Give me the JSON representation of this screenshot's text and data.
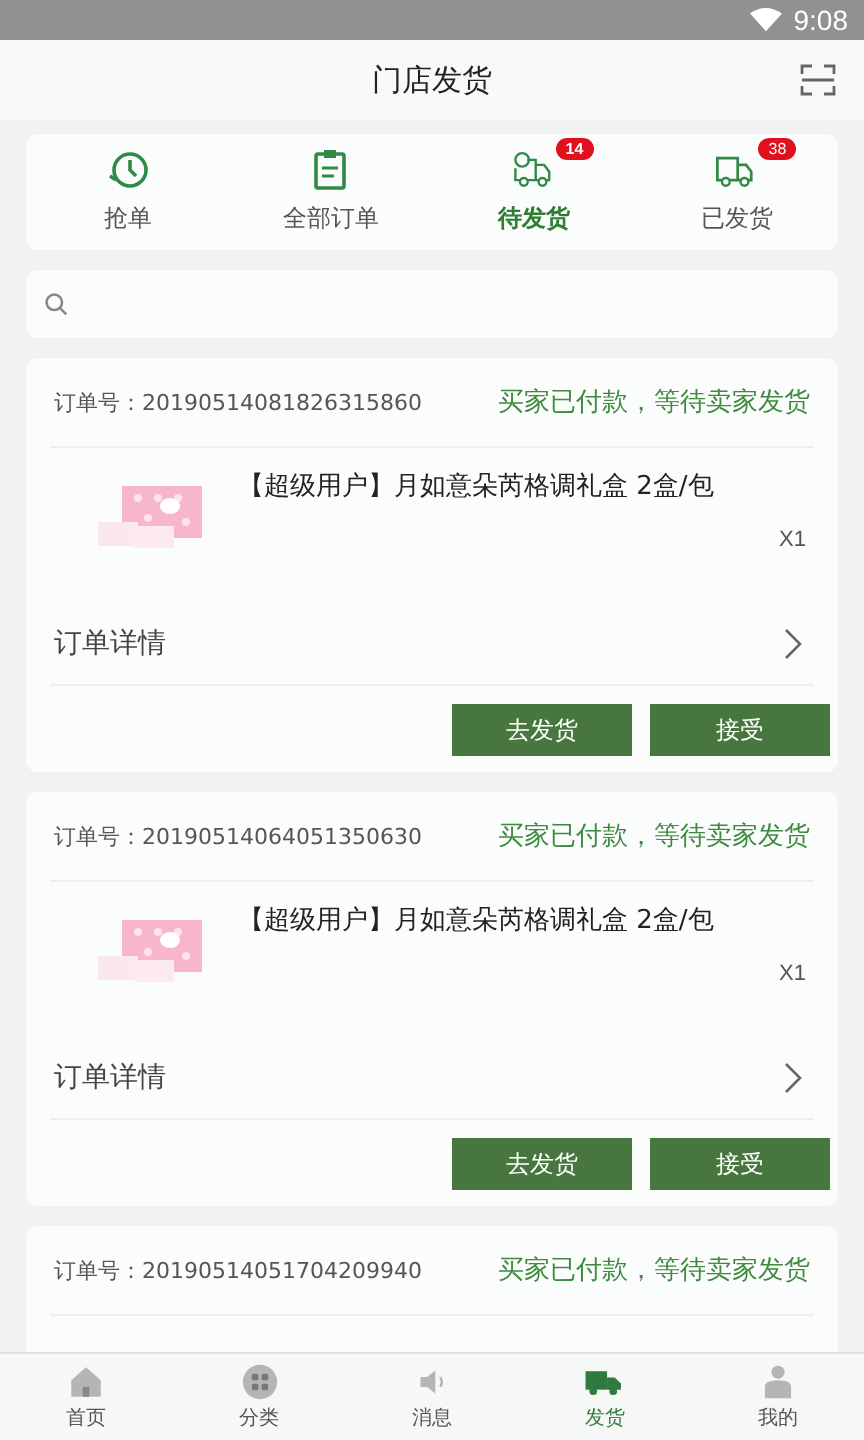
{
  "status_bar": {
    "time": "9:08"
  },
  "header": {
    "title": "门店发货"
  },
  "nav": [
    {
      "label": "抢单",
      "kind": "grab",
      "selected": false
    },
    {
      "label": "全部订单",
      "kind": "list",
      "selected": false
    },
    {
      "label": "待发货",
      "kind": "pending",
      "selected": true,
      "badge": "14"
    },
    {
      "label": "已发货",
      "kind": "shipped",
      "selected": false,
      "badge": "38"
    }
  ],
  "orders": [
    {
      "order_label": "订单号：",
      "order_no": "20190514081826315860",
      "status": "买家已付款，等待卖家发货",
      "product": "【超级用户】月如意朵芮格调礼盒 2盒/包",
      "quantity": "X1",
      "detail": "订单详情",
      "buttons": [
        "去发货",
        "接受"
      ]
    },
    {
      "order_label": "订单号：",
      "order_no": "20190514064051350630",
      "status": "买家已付款，等待卖家发货",
      "product": "【超级用户】月如意朵芮格调礼盒 2盒/包",
      "quantity": "X1",
      "detail": "订单详情",
      "buttons": [
        "去发货",
        "接受"
      ]
    },
    {
      "order_label": "订单号：",
      "order_no": "20190514051704209940",
      "status": "买家已付款，等待卖家发货"
    }
  ],
  "tab_bar": [
    {
      "label": "首页",
      "kind": "home",
      "selected": false
    },
    {
      "label": "分类",
      "kind": "category",
      "selected": false
    },
    {
      "label": "消息",
      "kind": "message",
      "selected": false
    },
    {
      "label": "发货",
      "kind": "truck",
      "selected": true
    },
    {
      "label": "我的",
      "kind": "user",
      "selected": false
    }
  ]
}
